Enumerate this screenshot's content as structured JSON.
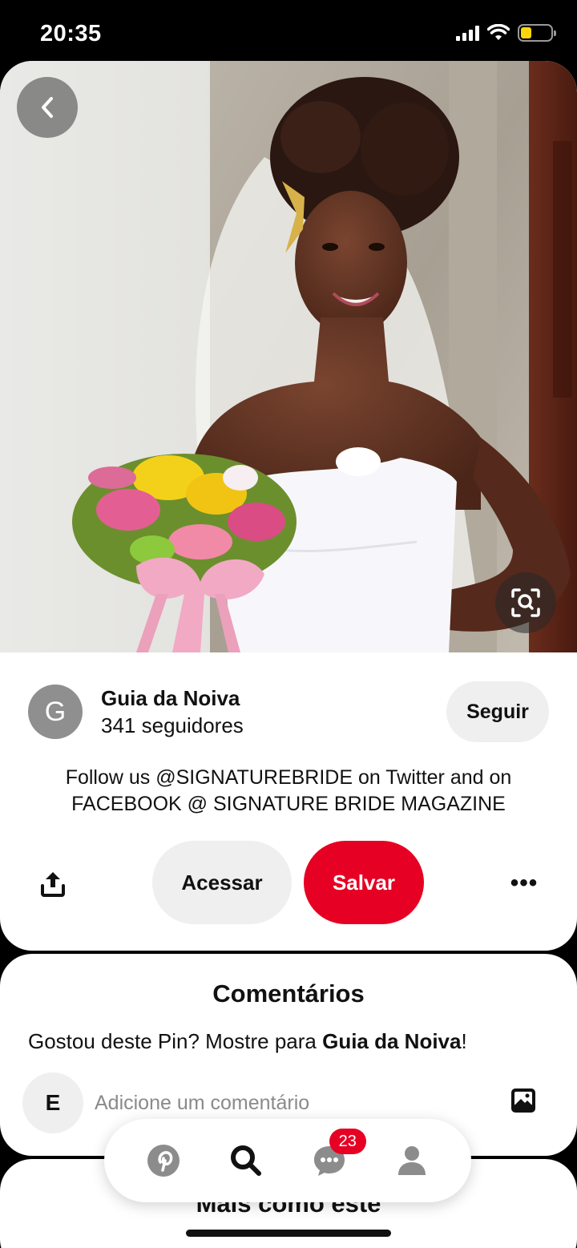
{
  "status_bar": {
    "time": "20:35",
    "icons": [
      "cellular-signal-icon",
      "wifi-icon",
      "battery-low-icon"
    ],
    "battery_color": "#ffd60a"
  },
  "pin": {
    "image_alt": "Noiva com buquê de flores",
    "creator": {
      "avatar_letter": "G",
      "name": "Guia da Noiva",
      "followers": "341 seguidores",
      "follow_label": "Seguir"
    },
    "description": "Follow us @SIGNATUREBRIDE on Twitter and on FACEBOOK @ SIGNATURE BRIDE MAGAZINE",
    "actions": {
      "visit_label": "Acessar",
      "save_label": "Salvar",
      "more_label": "•••"
    }
  },
  "comments": {
    "title": "Comentários",
    "prompt_prefix": "Gostou deste Pin? Mostre para ",
    "prompt_name": "Guia da Noiva",
    "prompt_suffix": "!",
    "user_avatar_letter": "E",
    "input_placeholder": "Adicione um comentário"
  },
  "more_like_this": {
    "title": "Mais como este"
  },
  "bottom_nav": {
    "items": [
      {
        "icon": "pinterest-logo-icon",
        "label": "Página inicial"
      },
      {
        "icon": "search-icon",
        "label": "Pesquisar"
      },
      {
        "icon": "messages-icon",
        "label": "Mensagens",
        "badge": "23"
      },
      {
        "icon": "profile-icon",
        "label": "Perfil"
      }
    ]
  },
  "colors": {
    "brand_red": "#e60023",
    "button_gray": "#efefef"
  }
}
